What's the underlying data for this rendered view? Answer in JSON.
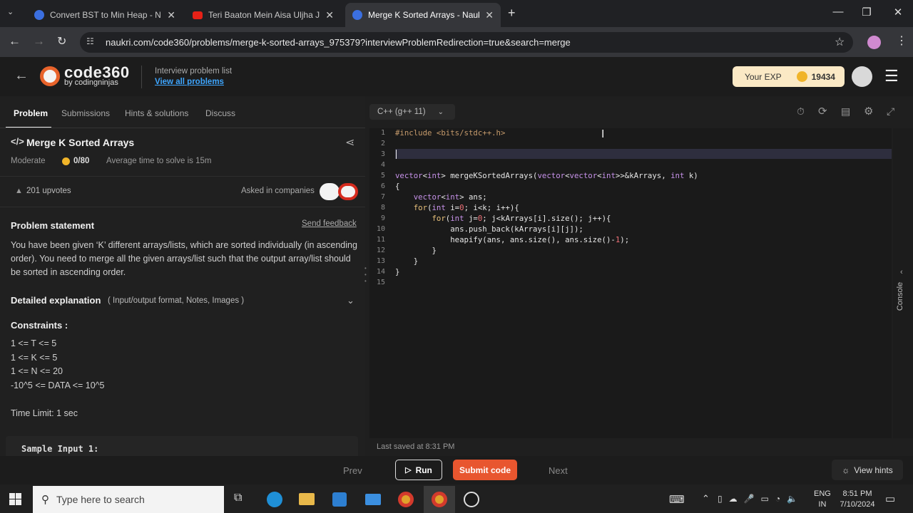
{
  "browser": {
    "tabs": [
      {
        "title": "Convert BST to Min Heap - Naukri",
        "icon_color": "#3b6fe0"
      },
      {
        "title": "Teri Baaton Mein Aisa Uljha Jiya",
        "icon_color": "#e62117"
      },
      {
        "title": "Merge K Sorted Arrays - Naukri",
        "icon_color": "#3b6fe0"
      }
    ],
    "new_tab": "+",
    "url": "naukri.com/code360/problems/merge-k-sorted-arrays_975379?interviewProblemRedirection=true&search=merge"
  },
  "site": {
    "logo_main": "code360",
    "logo_sub": "by codingninjas",
    "list_title": "Interview problem list",
    "list_link": "View all problems",
    "exp_label": "Your EXP",
    "exp_value": "19434"
  },
  "problem": {
    "tabs": [
      "Problem",
      "Submissions",
      "Hints & solutions",
      "Discuss"
    ],
    "title": "Merge K Sorted Arrays",
    "difficulty": "Moderate",
    "score": "0/80",
    "avg_time": "Average time to solve is 15m",
    "upvotes": "201 upvotes",
    "asked_in": "Asked in companies",
    "statement_heading": "Problem statement",
    "feedback": "Send feedback",
    "statement": "You have been given ‘K’ different arrays/lists, which are sorted individually (in ascending order). You need to merge all the given arrays/list such that the output array/list should be sorted in ascending order.",
    "detailed_heading": "Detailed explanation",
    "detailed_sub": "( Input/output format, Notes, Images )",
    "constraints_heading": "Constraints :",
    "constraints": [
      "1 <= T <= 5",
      "1 <= K <= 5",
      "1 <= N <= 20",
      "-10^5 <= DATA <= 10^5"
    ],
    "time_limit": "Time Limit: 1 sec",
    "sample_input": "Sample Input 1:"
  },
  "editor": {
    "language": "C++ (g++ 11)",
    "line_numbers": [
      "1",
      "2",
      "3",
      "4",
      "5",
      "6",
      "7",
      "8",
      "9",
      "10",
      "11",
      "12",
      "13",
      "14",
      "15"
    ],
    "last_saved": "Last saved at 8:31 PM",
    "console": "Console"
  },
  "bottom": {
    "prev": "Prev",
    "run": "Run",
    "submit": "Submit code",
    "next": "Next",
    "hints": "View hints"
  },
  "taskbar": {
    "search_placeholder": "Type here to search",
    "lang1": "ENG",
    "lang2": "IN",
    "time": "8:51 PM",
    "date": "7/10/2024"
  },
  "colors": {
    "accent": "#e8632b",
    "link": "#3ea6ff",
    "exp_bg": "#fbe9c5",
    "submit": "#e8562f"
  }
}
